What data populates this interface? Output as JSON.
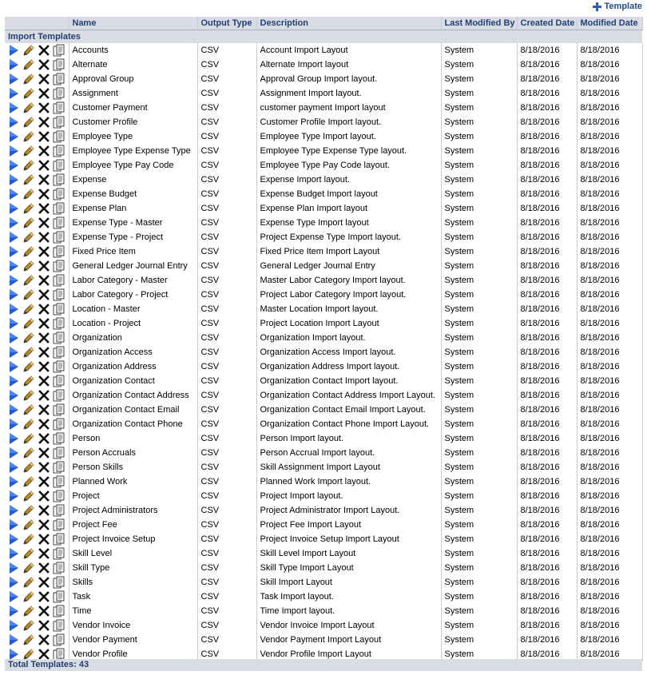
{
  "toolbar": {
    "add_label": "Template"
  },
  "columns": [
    "Name",
    "Output Type",
    "Description",
    "Last Modified By",
    "Created Date",
    "Modified Date"
  ],
  "group_label": "Import Templates",
  "rows": [
    {
      "name": "Accounts",
      "type": "CSV",
      "desc": "Account Import Layout",
      "by": "System",
      "created": "8/18/2016",
      "modified": "8/18/2016"
    },
    {
      "name": "Alternate",
      "type": "CSV",
      "desc": "Alternate Import layout",
      "by": "System",
      "created": "8/18/2016",
      "modified": "8/18/2016"
    },
    {
      "name": "Approval Group",
      "type": "CSV",
      "desc": "Approval Group Import layout.",
      "by": "System",
      "created": "8/18/2016",
      "modified": "8/18/2016"
    },
    {
      "name": "Assignment",
      "type": "CSV",
      "desc": "Assignment Import layout.",
      "by": "System",
      "created": "8/18/2016",
      "modified": "8/18/2016"
    },
    {
      "name": "Customer Payment",
      "type": "CSV",
      "desc": "customer payment Import layout",
      "by": "System",
      "created": "8/18/2016",
      "modified": "8/18/2016"
    },
    {
      "name": "Customer Profile",
      "type": "CSV",
      "desc": "Customer Profile Import layout.",
      "by": "System",
      "created": "8/18/2016",
      "modified": "8/18/2016"
    },
    {
      "name": "Employee Type",
      "type": "CSV",
      "desc": "Employee Type Import layout.",
      "by": "System",
      "created": "8/18/2016",
      "modified": "8/18/2016"
    },
    {
      "name": "Employee Type Expense Type",
      "type": "CSV",
      "desc": "Employee Type Expense Type layout.",
      "by": "System",
      "created": "8/18/2016",
      "modified": "8/18/2016"
    },
    {
      "name": "Employee Type Pay Code",
      "type": "CSV",
      "desc": "Employee Type Pay Code layout.",
      "by": "System",
      "created": "8/18/2016",
      "modified": "8/18/2016"
    },
    {
      "name": "Expense",
      "type": "CSV",
      "desc": "Expense Import layout.",
      "by": "System",
      "created": "8/18/2016",
      "modified": "8/18/2016"
    },
    {
      "name": "Expense Budget",
      "type": "CSV",
      "desc": "Expense Budget Import layout",
      "by": "System",
      "created": "8/18/2016",
      "modified": "8/18/2016"
    },
    {
      "name": "Expense Plan",
      "type": "CSV",
      "desc": "Expense Plan Import layout",
      "by": "System",
      "created": "8/18/2016",
      "modified": "8/18/2016"
    },
    {
      "name": "Expense Type - Master",
      "type": "CSV",
      "desc": "Expense Type Import layout",
      "by": "System",
      "created": "8/18/2016",
      "modified": "8/18/2016"
    },
    {
      "name": "Expense Type - Project",
      "type": "CSV",
      "desc": "Project Expense Type Import layout.",
      "by": "System",
      "created": "8/18/2016",
      "modified": "8/18/2016"
    },
    {
      "name": "Fixed Price Item",
      "type": "CSV",
      "desc": "Fixed Price Item Import Layout",
      "by": "System",
      "created": "8/18/2016",
      "modified": "8/18/2016"
    },
    {
      "name": "General Ledger Journal Entry",
      "type": "CSV",
      "desc": "General Ledger Journal Entry",
      "by": "System",
      "created": "8/18/2016",
      "modified": "8/18/2016"
    },
    {
      "name": "Labor Category - Master",
      "type": "CSV",
      "desc": "Master Labor Category Import layout.",
      "by": "System",
      "created": "8/18/2016",
      "modified": "8/18/2016"
    },
    {
      "name": "Labor Category - Project",
      "type": "CSV",
      "desc": "Project Labor Category Import layout.",
      "by": "System",
      "created": "8/18/2016",
      "modified": "8/18/2016"
    },
    {
      "name": "Location - Master",
      "type": "CSV",
      "desc": "Master Location Import layout.",
      "by": "System",
      "created": "8/18/2016",
      "modified": "8/18/2016"
    },
    {
      "name": "Location - Project",
      "type": "CSV",
      "desc": "Project Location Import Layout",
      "by": "System",
      "created": "8/18/2016",
      "modified": "8/18/2016"
    },
    {
      "name": "Organization",
      "type": "CSV",
      "desc": "Organization Import layout.",
      "by": "System",
      "created": "8/18/2016",
      "modified": "8/18/2016"
    },
    {
      "name": "Organization Access",
      "type": "CSV",
      "desc": "Organization Access Import layout.",
      "by": "System",
      "created": "8/18/2016",
      "modified": "8/18/2016"
    },
    {
      "name": "Organization Address",
      "type": "CSV",
      "desc": "Organization Address Import layout.",
      "by": "System",
      "created": "8/18/2016",
      "modified": "8/18/2016"
    },
    {
      "name": "Organization Contact",
      "type": "CSV",
      "desc": "Organization Contact Import layout.",
      "by": "System",
      "created": "8/18/2016",
      "modified": "8/18/2016"
    },
    {
      "name": "Organization Contact Address",
      "type": "CSV",
      "desc": "Organization Contact Address Import Layout.",
      "by": "System",
      "created": "8/18/2016",
      "modified": "8/18/2016"
    },
    {
      "name": "Organization Contact Email",
      "type": "CSV",
      "desc": "Organization Contact Email Import Layout.",
      "by": "System",
      "created": "8/18/2016",
      "modified": "8/18/2016"
    },
    {
      "name": "Organization Contact Phone",
      "type": "CSV",
      "desc": "Organization Contact Phone Import Layout.",
      "by": "System",
      "created": "8/18/2016",
      "modified": "8/18/2016"
    },
    {
      "name": "Person",
      "type": "CSV",
      "desc": "Person Import layout.",
      "by": "System",
      "created": "8/18/2016",
      "modified": "8/18/2016"
    },
    {
      "name": "Person Accruals",
      "type": "CSV",
      "desc": "Person Accrual Import layout.",
      "by": "System",
      "created": "8/18/2016",
      "modified": "8/18/2016"
    },
    {
      "name": "Person Skills",
      "type": "CSV",
      "desc": "Skill Assignment Import Layout",
      "by": "System",
      "created": "8/18/2016",
      "modified": "8/18/2016"
    },
    {
      "name": "Planned Work",
      "type": "CSV",
      "desc": "Planned Work Import layout.",
      "by": "System",
      "created": "8/18/2016",
      "modified": "8/18/2016"
    },
    {
      "name": "Project",
      "type": "CSV",
      "desc": "Project Import layout.",
      "by": "System",
      "created": "8/18/2016",
      "modified": "8/18/2016"
    },
    {
      "name": "Project Administrators",
      "type": "CSV",
      "desc": "Project Administrator Import Layout.",
      "by": "System",
      "created": "8/18/2016",
      "modified": "8/18/2016"
    },
    {
      "name": "Project Fee",
      "type": "CSV",
      "desc": "Project Fee Import Layout",
      "by": "System",
      "created": "8/18/2016",
      "modified": "8/18/2016"
    },
    {
      "name": "Project Invoice Setup",
      "type": "CSV",
      "desc": "Project Invoice Setup Import Layout",
      "by": "System",
      "created": "8/18/2016",
      "modified": "8/18/2016"
    },
    {
      "name": "Skill Level",
      "type": "CSV",
      "desc": "Skill Level Import Layout",
      "by": "System",
      "created": "8/18/2016",
      "modified": "8/18/2016"
    },
    {
      "name": "Skill Type",
      "type": "CSV",
      "desc": "Skill Type Import Layout",
      "by": "System",
      "created": "8/18/2016",
      "modified": "8/18/2016"
    },
    {
      "name": "Skills",
      "type": "CSV",
      "desc": "Skill Import Layout",
      "by": "System",
      "created": "8/18/2016",
      "modified": "8/18/2016"
    },
    {
      "name": "Task",
      "type": "CSV",
      "desc": "Task Import layout.",
      "by": "System",
      "created": "8/18/2016",
      "modified": "8/18/2016"
    },
    {
      "name": "Time",
      "type": "CSV",
      "desc": "Time Import layout.",
      "by": "System",
      "created": "8/18/2016",
      "modified": "8/18/2016"
    },
    {
      "name": "Vendor Invoice",
      "type": "CSV",
      "desc": "Vendor Invoice Import Layout",
      "by": "System",
      "created": "8/18/2016",
      "modified": "8/18/2016"
    },
    {
      "name": "Vendor Payment",
      "type": "CSV",
      "desc": "Vendor Payment Import Layout",
      "by": "System",
      "created": "8/18/2016",
      "modified": "8/18/2016"
    },
    {
      "name": "Vendor Profile",
      "type": "CSV",
      "desc": "Vendor Profile Import Layout",
      "by": "System",
      "created": "8/18/2016",
      "modified": "8/18/2016"
    }
  ],
  "footer": {
    "total_label": "Total Templates: 43"
  },
  "icons": {
    "add": "plus-icon",
    "run": "run-arrow-icon",
    "edit": "pencil-icon",
    "delete": "delete-x-icon",
    "copy": "copy-document-icon"
  },
  "colors": {
    "header_bg": "#d9dde3",
    "header_text": "#213f73",
    "run_icon": "#1f5bd6",
    "link": "#1f4d8a"
  }
}
